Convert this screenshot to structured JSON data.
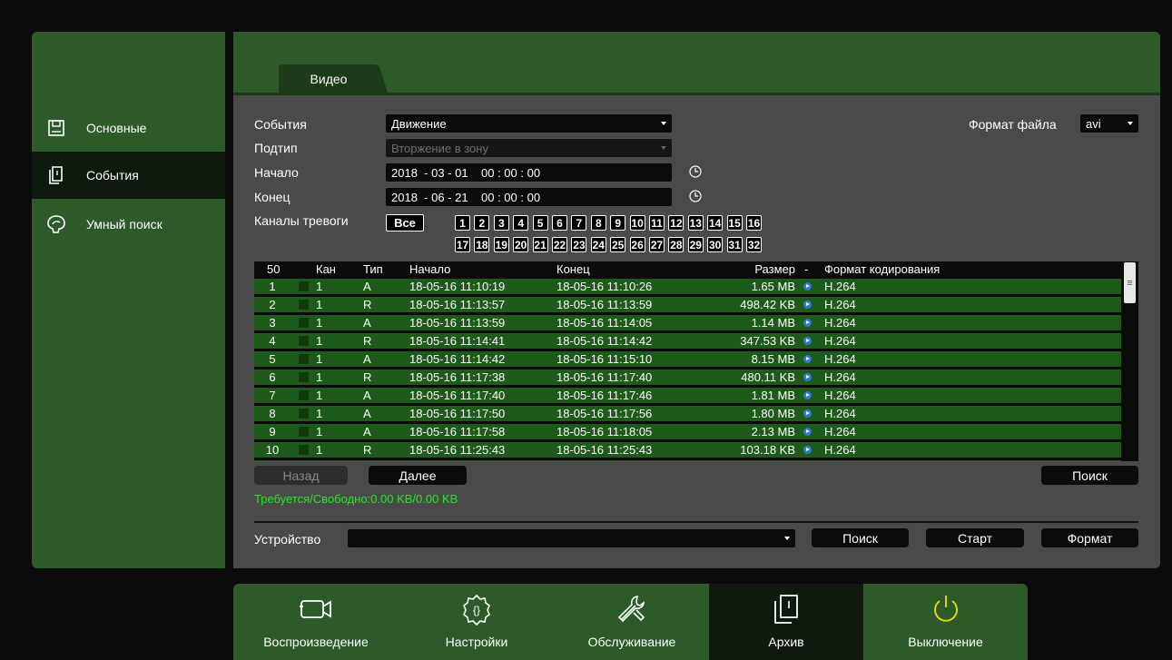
{
  "sidebar": {
    "items": [
      {
        "label": "Основные",
        "icon": "save-icon"
      },
      {
        "label": "События",
        "icon": "documents-icon"
      },
      {
        "label": "Умный поиск",
        "icon": "smart-search-icon"
      }
    ],
    "active_index": 1
  },
  "tab": {
    "label": "Видео"
  },
  "form": {
    "events_label": "События",
    "events_value": "Движение",
    "subtype_label": "Подтип",
    "subtype_value": "Вторжение в зону",
    "start_label": "Начало",
    "start_value": "2018  - 03 - 01    00 : 00 : 00",
    "end_label": "Конец",
    "end_value": "2018  - 06 - 21    00 : 00 : 00",
    "file_format_label": "Формат файла",
    "file_format_value": "avi",
    "alarm_channels_label": "Каналы тревоги",
    "all_label": "Все",
    "channels": [
      "1",
      "2",
      "3",
      "4",
      "5",
      "6",
      "7",
      "8",
      "9",
      "10",
      "11",
      "12",
      "13",
      "14",
      "15",
      "16",
      "17",
      "18",
      "19",
      "20",
      "21",
      "22",
      "23",
      "24",
      "25",
      "26",
      "27",
      "28",
      "29",
      "30",
      "31",
      "32"
    ]
  },
  "table": {
    "headers": {
      "num": "50",
      "channel": "Кан",
      "type": "Тип",
      "start": "Начало",
      "end": "Конец",
      "size": "Размер",
      "dash": "-",
      "codec": "Формат кодирования"
    },
    "rows": [
      {
        "num": "1",
        "channel": "1",
        "type": "A",
        "start": "18-05-16 11:10:19",
        "end": "18-05-16 11:10:26",
        "size": "1.65 MB",
        "codec": "H.264"
      },
      {
        "num": "2",
        "channel": "1",
        "type": "R",
        "start": "18-05-16 11:13:57",
        "end": "18-05-16 11:13:59",
        "size": "498.42 KB",
        "codec": "H.264"
      },
      {
        "num": "3",
        "channel": "1",
        "type": "A",
        "start": "18-05-16 11:13:59",
        "end": "18-05-16 11:14:05",
        "size": "1.14 MB",
        "codec": "H.264"
      },
      {
        "num": "4",
        "channel": "1",
        "type": "R",
        "start": "18-05-16 11:14:41",
        "end": "18-05-16 11:14:42",
        "size": "347.53 KB",
        "codec": "H.264"
      },
      {
        "num": "5",
        "channel": "1",
        "type": "A",
        "start": "18-05-16 11:14:42",
        "end": "18-05-16 11:15:10",
        "size": "8.15 MB",
        "codec": "H.264"
      },
      {
        "num": "6",
        "channel": "1",
        "type": "R",
        "start": "18-05-16 11:17:38",
        "end": "18-05-16 11:17:40",
        "size": "480.11 KB",
        "codec": "H.264"
      },
      {
        "num": "7",
        "channel": "1",
        "type": "A",
        "start": "18-05-16 11:17:40",
        "end": "18-05-16 11:17:46",
        "size": "1.81 MB",
        "codec": "H.264"
      },
      {
        "num": "8",
        "channel": "1",
        "type": "A",
        "start": "18-05-16 11:17:50",
        "end": "18-05-16 11:17:56",
        "size": "1.80 MB",
        "codec": "H.264"
      },
      {
        "num": "9",
        "channel": "1",
        "type": "A",
        "start": "18-05-16 11:17:58",
        "end": "18-05-16 11:18:05",
        "size": "2.13 MB",
        "codec": "H.264"
      },
      {
        "num": "10",
        "channel": "1",
        "type": "R",
        "start": "18-05-16 11:25:43",
        "end": "18-05-16 11:25:43",
        "size": "103.18 KB",
        "codec": "H.264"
      }
    ]
  },
  "buttons": {
    "back": "Назад",
    "next": "Далее",
    "search": "Поиск",
    "search2": "Поиск",
    "start": "Старт",
    "format": "Формат"
  },
  "status_text": "Требуется/Свободно:0.00 KB/0.00 KB",
  "device_label": "Устройство",
  "device_value": "",
  "bottom_nav": [
    {
      "label": "Воспроизведение",
      "icon": "video-camera-icon"
    },
    {
      "label": "Настройки",
      "icon": "settings-gear-icon"
    },
    {
      "label": "Обслуживание",
      "icon": "tools-icon"
    },
    {
      "label": "Архив",
      "icon": "archive-documents-icon"
    },
    {
      "label": "Выключение",
      "icon": "power-icon"
    }
  ],
  "bottom_active_index": 3,
  "colors": {
    "panel_green": "#2c5a28",
    "row_green": "#1e5a1a",
    "status_green": "#22e822",
    "power_yellow": "#f0e000"
  }
}
